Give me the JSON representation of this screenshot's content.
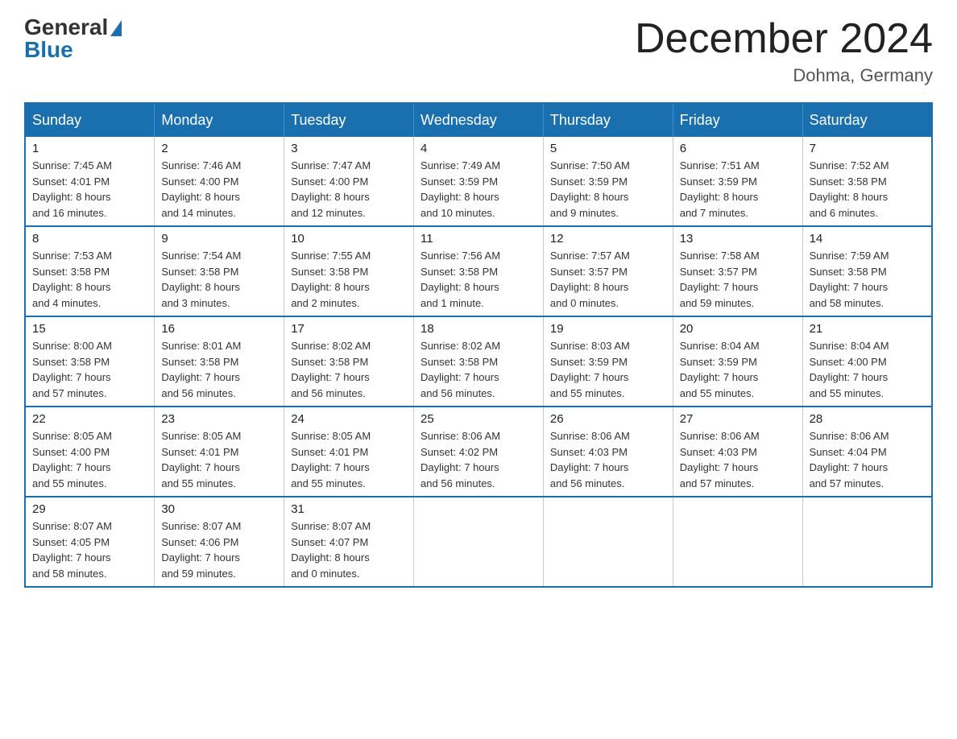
{
  "header": {
    "logo_general": "General",
    "logo_blue": "Blue",
    "month_title": "December 2024",
    "location": "Dohma, Germany"
  },
  "weekdays": [
    "Sunday",
    "Monday",
    "Tuesday",
    "Wednesday",
    "Thursday",
    "Friday",
    "Saturday"
  ],
  "weeks": [
    [
      {
        "day": "1",
        "sunrise": "7:45 AM",
        "sunset": "4:01 PM",
        "daylight": "8 hours and 16 minutes."
      },
      {
        "day": "2",
        "sunrise": "7:46 AM",
        "sunset": "4:00 PM",
        "daylight": "8 hours and 14 minutes."
      },
      {
        "day": "3",
        "sunrise": "7:47 AM",
        "sunset": "4:00 PM",
        "daylight": "8 hours and 12 minutes."
      },
      {
        "day": "4",
        "sunrise": "7:49 AM",
        "sunset": "3:59 PM",
        "daylight": "8 hours and 10 minutes."
      },
      {
        "day": "5",
        "sunrise": "7:50 AM",
        "sunset": "3:59 PM",
        "daylight": "8 hours and 9 minutes."
      },
      {
        "day": "6",
        "sunrise": "7:51 AM",
        "sunset": "3:59 PM",
        "daylight": "8 hours and 7 minutes."
      },
      {
        "day": "7",
        "sunrise": "7:52 AM",
        "sunset": "3:58 PM",
        "daylight": "8 hours and 6 minutes."
      }
    ],
    [
      {
        "day": "8",
        "sunrise": "7:53 AM",
        "sunset": "3:58 PM",
        "daylight": "8 hours and 4 minutes."
      },
      {
        "day": "9",
        "sunrise": "7:54 AM",
        "sunset": "3:58 PM",
        "daylight": "8 hours and 3 minutes."
      },
      {
        "day": "10",
        "sunrise": "7:55 AM",
        "sunset": "3:58 PM",
        "daylight": "8 hours and 2 minutes."
      },
      {
        "day": "11",
        "sunrise": "7:56 AM",
        "sunset": "3:58 PM",
        "daylight": "8 hours and 1 minute."
      },
      {
        "day": "12",
        "sunrise": "7:57 AM",
        "sunset": "3:57 PM",
        "daylight": "8 hours and 0 minutes."
      },
      {
        "day": "13",
        "sunrise": "7:58 AM",
        "sunset": "3:57 PM",
        "daylight": "7 hours and 59 minutes."
      },
      {
        "day": "14",
        "sunrise": "7:59 AM",
        "sunset": "3:58 PM",
        "daylight": "7 hours and 58 minutes."
      }
    ],
    [
      {
        "day": "15",
        "sunrise": "8:00 AM",
        "sunset": "3:58 PM",
        "daylight": "7 hours and 57 minutes."
      },
      {
        "day": "16",
        "sunrise": "8:01 AM",
        "sunset": "3:58 PM",
        "daylight": "7 hours and 56 minutes."
      },
      {
        "day": "17",
        "sunrise": "8:02 AM",
        "sunset": "3:58 PM",
        "daylight": "7 hours and 56 minutes."
      },
      {
        "day": "18",
        "sunrise": "8:02 AM",
        "sunset": "3:58 PM",
        "daylight": "7 hours and 56 minutes."
      },
      {
        "day": "19",
        "sunrise": "8:03 AM",
        "sunset": "3:59 PM",
        "daylight": "7 hours and 55 minutes."
      },
      {
        "day": "20",
        "sunrise": "8:04 AM",
        "sunset": "3:59 PM",
        "daylight": "7 hours and 55 minutes."
      },
      {
        "day": "21",
        "sunrise": "8:04 AM",
        "sunset": "4:00 PM",
        "daylight": "7 hours and 55 minutes."
      }
    ],
    [
      {
        "day": "22",
        "sunrise": "8:05 AM",
        "sunset": "4:00 PM",
        "daylight": "7 hours and 55 minutes."
      },
      {
        "day": "23",
        "sunrise": "8:05 AM",
        "sunset": "4:01 PM",
        "daylight": "7 hours and 55 minutes."
      },
      {
        "day": "24",
        "sunrise": "8:05 AM",
        "sunset": "4:01 PM",
        "daylight": "7 hours and 55 minutes."
      },
      {
        "day": "25",
        "sunrise": "8:06 AM",
        "sunset": "4:02 PM",
        "daylight": "7 hours and 56 minutes."
      },
      {
        "day": "26",
        "sunrise": "8:06 AM",
        "sunset": "4:03 PM",
        "daylight": "7 hours and 56 minutes."
      },
      {
        "day": "27",
        "sunrise": "8:06 AM",
        "sunset": "4:03 PM",
        "daylight": "7 hours and 57 minutes."
      },
      {
        "day": "28",
        "sunrise": "8:06 AM",
        "sunset": "4:04 PM",
        "daylight": "7 hours and 57 minutes."
      }
    ],
    [
      {
        "day": "29",
        "sunrise": "8:07 AM",
        "sunset": "4:05 PM",
        "daylight": "7 hours and 58 minutes."
      },
      {
        "day": "30",
        "sunrise": "8:07 AM",
        "sunset": "4:06 PM",
        "daylight": "7 hours and 59 minutes."
      },
      {
        "day": "31",
        "sunrise": "8:07 AM",
        "sunset": "4:07 PM",
        "daylight": "8 hours and 0 minutes."
      },
      null,
      null,
      null,
      null
    ]
  ],
  "labels": {
    "sunrise": "Sunrise:",
    "sunset": "Sunset:",
    "daylight": "Daylight:"
  }
}
